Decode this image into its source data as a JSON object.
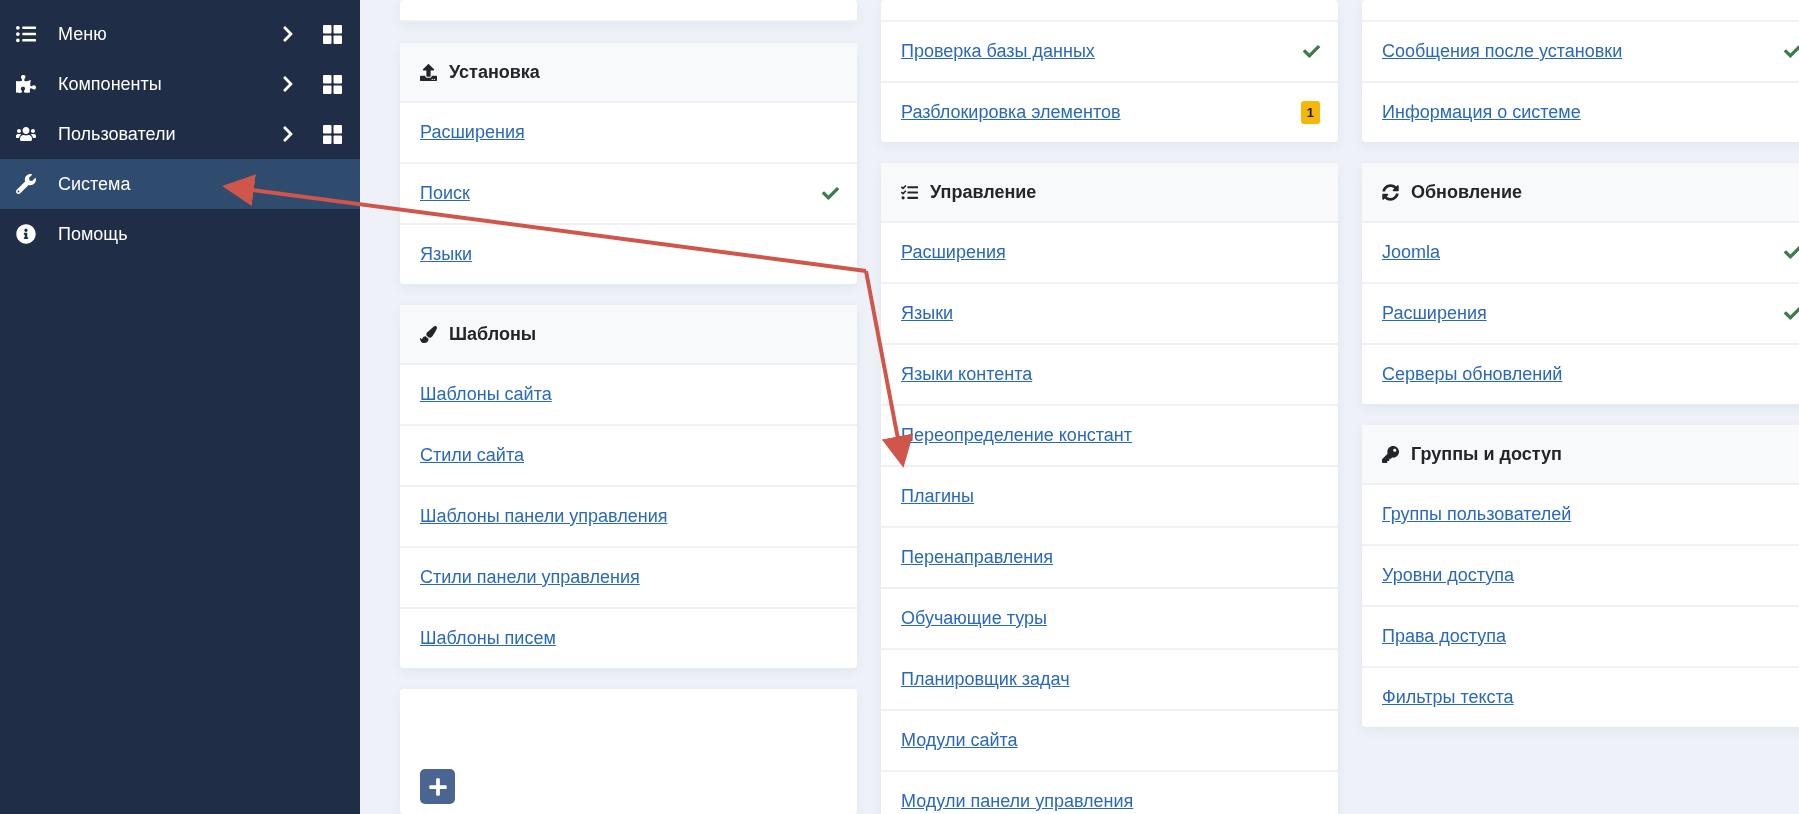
{
  "sidebar": {
    "items": [
      {
        "label": "Меню",
        "expandable": true,
        "selected": false
      },
      {
        "label": "Компоненты",
        "expandable": true,
        "selected": false
      },
      {
        "label": "Пользователи",
        "expandable": true,
        "selected": false
      },
      {
        "label": "Система",
        "expandable": false,
        "selected": true
      },
      {
        "label": "Помощь",
        "expandable": false,
        "selected": false
      }
    ]
  },
  "columns": [
    {
      "cards": [
        {
          "kind": "cut"
        },
        {
          "kind": "list",
          "title": "Установка",
          "rows": [
            {
              "label": "Расширения",
              "kind": "plain"
            },
            {
              "label": "Поиск",
              "kind": "check"
            },
            {
              "label": "Языки",
              "kind": "plain"
            }
          ]
        },
        {
          "kind": "list",
          "title": "Шаблоны",
          "rows": [
            {
              "label": "Шаблоны сайта",
              "kind": "plain"
            },
            {
              "label": "Стили сайта",
              "kind": "plain"
            },
            {
              "label": "Шаблоны панели управления",
              "kind": "plain"
            },
            {
              "label": "Стили панели управления",
              "kind": "plain"
            },
            {
              "label": "Шаблоны писем",
              "kind": "plain"
            }
          ]
        },
        {
          "kind": "add"
        }
      ]
    },
    {
      "cards": [
        {
          "kind": "cut",
          "rows": [
            {
              "label": "Проверка базы данных",
              "kind": "check"
            },
            {
              "label": "Разблокировка элементов",
              "kind": "badge",
              "badge": "1"
            }
          ]
        },
        {
          "kind": "list",
          "title": "Управление",
          "rows": [
            {
              "label": "Расширения",
              "kind": "plain"
            },
            {
              "label": "Языки",
              "kind": "plain"
            },
            {
              "label": "Языки контента",
              "kind": "plain"
            },
            {
              "label": "Переопределение констант",
              "kind": "plain"
            },
            {
              "label": "Плагины",
              "kind": "plain"
            },
            {
              "label": "Перенаправления",
              "kind": "plain"
            },
            {
              "label": "Обучающие туры",
              "kind": "plain"
            },
            {
              "label": "Планировщик задач",
              "kind": "plain"
            },
            {
              "label": "Модули сайта",
              "kind": "plain"
            },
            {
              "label": "Модули панели управления",
              "kind": "plain"
            }
          ]
        }
      ]
    },
    {
      "cards": [
        {
          "kind": "cut",
          "rows": [
            {
              "label": "Сообщения после установки",
              "kind": "check"
            },
            {
              "label": "Информация о системе",
              "kind": "plain"
            }
          ]
        },
        {
          "kind": "list",
          "title": "Обновление",
          "rows": [
            {
              "label": "Joomla",
              "kind": "check"
            },
            {
              "label": "Расширения",
              "kind": "check"
            },
            {
              "label": "Серверы обновлений",
              "kind": "plain"
            }
          ]
        },
        {
          "kind": "list",
          "title": "Группы и доступ",
          "rows": [
            {
              "label": "Группы пользователей",
              "kind": "plain"
            },
            {
              "label": "Уровни доступа",
              "kind": "plain"
            },
            {
              "label": "Права доступа",
              "kind": "plain"
            },
            {
              "label": "Фильтры текста",
              "kind": "plain"
            }
          ]
        }
      ]
    }
  ]
}
